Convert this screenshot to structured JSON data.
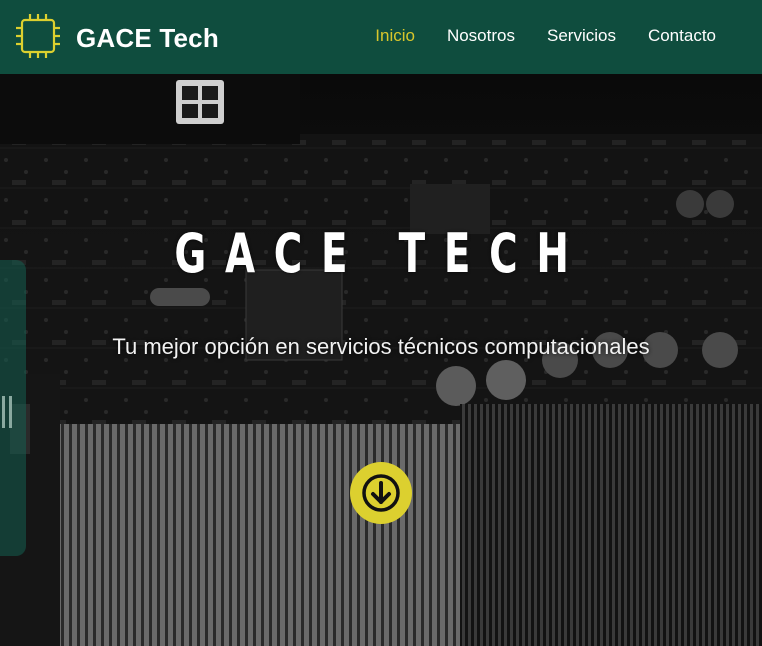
{
  "brand": {
    "name": "GACE Tech",
    "logo_icon": "chip-icon"
  },
  "nav": {
    "items": [
      {
        "label": "Inicio",
        "active": true
      },
      {
        "label": "Nosotros",
        "active": false
      },
      {
        "label": "Servicios",
        "active": false
      },
      {
        "label": "Contacto",
        "active": false
      }
    ]
  },
  "hero": {
    "title": "GACE TECH",
    "subtitle": "Tu mejor opción en servicios técnicos computacionales",
    "scroll_icon": "arrow-down-icon"
  },
  "colors": {
    "navbar": "#0f4d3e",
    "accent": "#dcd02f",
    "active_link": "#d8c62b",
    "text": "#ffffff"
  }
}
